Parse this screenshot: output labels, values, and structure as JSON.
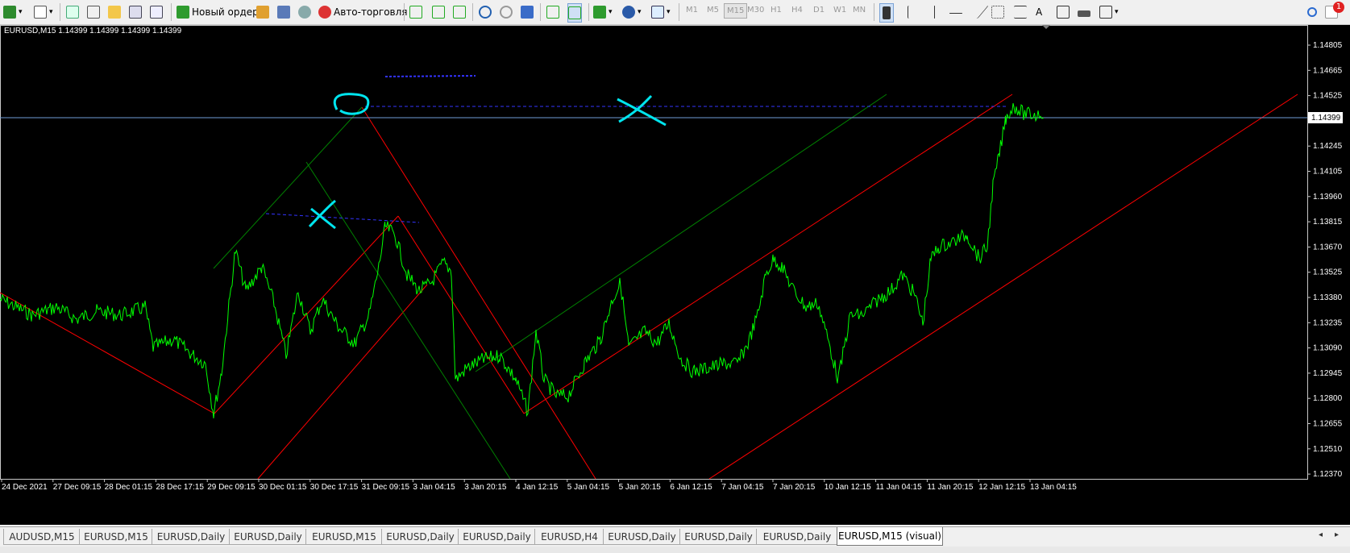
{
  "toolbar": {
    "new_order": "Новый ордер",
    "auto_trading": "Авто-торговля",
    "timeframes": [
      "M1",
      "M5",
      "M15",
      "M30",
      "H1",
      "H4",
      "D1",
      "W1",
      "MN"
    ],
    "notification_count": "1"
  },
  "chart": {
    "info": "EURUSD,M15  1.14399 1.14399 1.14399 1.14399",
    "current_price": "1.14399",
    "price_labels": [
      "1.14805",
      "1.14665",
      "1.14525",
      "1.14385",
      "1.14245",
      "1.14105",
      "1.13960",
      "1.13815",
      "1.13670",
      "1.13525",
      "1.13380",
      "1.13235",
      "1.13090",
      "1.12945",
      "1.12800",
      "1.12655",
      "1.12510",
      "1.12370"
    ],
    "time_labels": [
      "24 Dec 2021",
      "27 Dec 09:15",
      "28 Dec 01:15",
      "28 Dec 17:15",
      "29 Dec 09:15",
      "30 Dec 01:15",
      "30 Dec 17:15",
      "31 Dec 09:15",
      "3 Jan 04:15",
      "3 Jan 20:15",
      "4 Jan 12:15",
      "5 Jan 04:15",
      "5 Jan 20:15",
      "6 Jan 12:15",
      "7 Jan 04:15",
      "7 Jan 20:15",
      "10 Jan 12:15",
      "11 Jan 04:15",
      "11 Jan 20:15",
      "12 Jan 12:15",
      "13 Jan 04:15"
    ],
    "colors": {
      "price_line": "#00ff00",
      "channel_red": "#ff0000",
      "channel_green": "#008000",
      "annotation": "#00e5ee",
      "level_blue": "#3333ff"
    }
  },
  "tabs": [
    "AUDUSD,M15",
    "EURUSD,M15",
    "EURUSD,Daily",
    "EURUSD,Daily",
    "EURUSD,M15",
    "EURUSD,Daily",
    "EURUSD,Daily",
    "EURUSD,H4",
    "EURUSD,Daily",
    "EURUSD,Daily",
    "EURUSD,Daily",
    "EURUSD,M15 (visual)"
  ]
}
